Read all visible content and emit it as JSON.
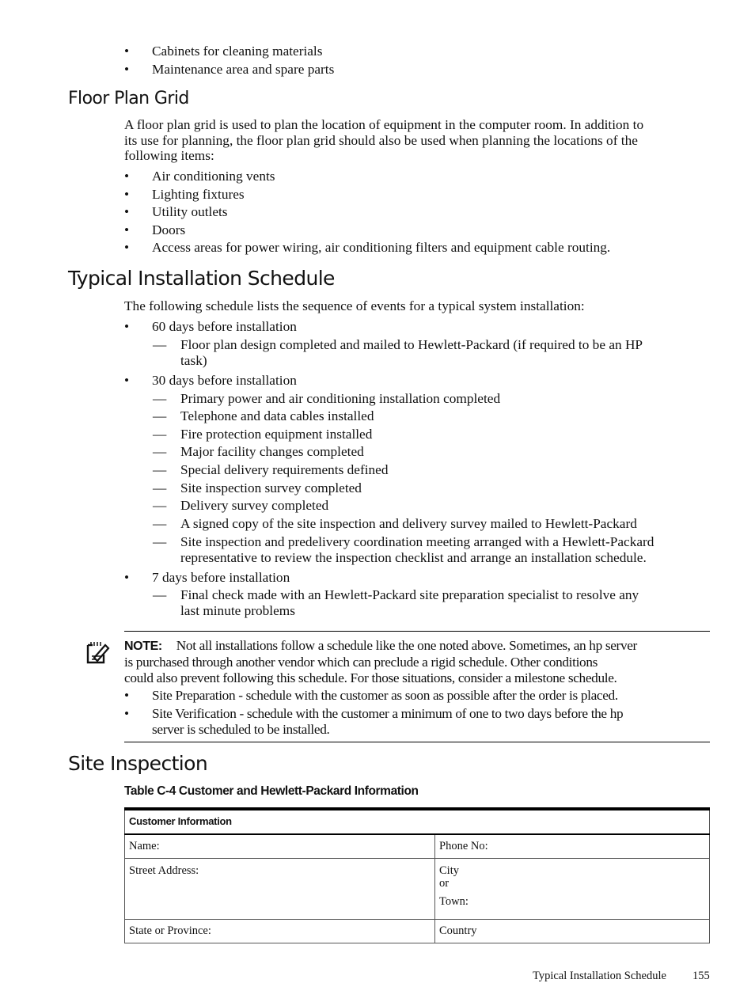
{
  "top_bullets": [
    "Cabinets for cleaning materials",
    "Maintenance area and spare parts"
  ],
  "floor_plan": {
    "heading": "Floor Plan Grid",
    "para_lines": [
      "A floor plan grid is used to plan the location of equipment in the computer room. In addition to",
      "its use for planning, the floor plan grid should also be used when planning the locations of the",
      "following items:"
    ],
    "bullets": [
      "Air conditioning vents",
      "Lighting fixtures",
      "Utility outlets",
      "Doors",
      "Access areas for power wiring, air conditioning filters and equipment cable routing."
    ]
  },
  "schedule": {
    "heading": "Typical Installation Schedule",
    "intro": "The following schedule lists the sequence of events for a typical system installation:",
    "bullet_glyph": "•",
    "dash_glyph": "—",
    "groups": [
      {
        "label": "60 days before installation",
        "items": [
          [
            "Floor plan design completed and mailed to Hewlett-Packard (if required to be an HP",
            "task)"
          ]
        ]
      },
      {
        "label": "30 days before installation",
        "items": [
          [
            "Primary power and air conditioning installation completed"
          ],
          [
            "Telephone and data cables installed"
          ],
          [
            "Fire protection equipment installed"
          ],
          [
            "Major facility changes completed"
          ],
          [
            "Special delivery requirements defined"
          ],
          [
            "Site inspection survey completed"
          ],
          [
            "Delivery survey completed"
          ],
          [
            "A signed copy of the site inspection and delivery survey mailed to Hewlett-Packard"
          ],
          [
            "Site inspection and predelivery coordination meeting arranged with a Hewlett-Packard",
            "representative to review the inspection checklist and arrange an installation schedule."
          ]
        ]
      },
      {
        "label": "7 days before installation",
        "items": [
          [
            "Final check made with an Hewlett-Packard site preparation specialist to resolve any",
            "last minute problems"
          ]
        ]
      }
    ]
  },
  "note": {
    "icon": "note-pencil-icon",
    "label": "NOTE:",
    "line1": "Not all installations follow a schedule like the one noted above. Sometimes, an hp server",
    "line2": "is purchased through another vendor which can preclude a rigid schedule. Other conditions",
    "line3": "could also prevent following this schedule. For those situations, consider a milestone schedule.",
    "bullets": [
      [
        "Site Preparation - schedule with the customer as soon as possible after the order is placed."
      ],
      [
        "Site Verification - schedule with the customer a minimum of one to two days before the hp",
        "server is scheduled to be installed."
      ]
    ]
  },
  "site_inspection": {
    "heading": "Site Inspection",
    "table_caption": "Table C-4 Customer and Hewlett-Packard Information",
    "table": {
      "header": "Customer Information",
      "rows": [
        [
          "Name:",
          "Phone No:"
        ],
        [
          "Street Address:",
          "City|or|Town:"
        ],
        [
          "State or Province:",
          "Country"
        ]
      ],
      "city_lines": [
        "City",
        "or",
        "Town:"
      ]
    }
  },
  "footer": {
    "section": "Typical Installation Schedule",
    "page": "155"
  }
}
